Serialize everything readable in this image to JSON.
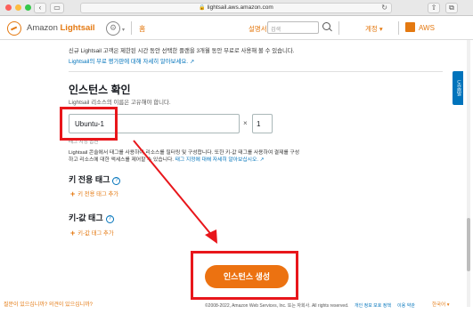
{
  "browser": {
    "url": "lightsail.aws.amazon.com"
  },
  "header": {
    "brand_prefix": "Amazon ",
    "brand_name": "Lightsail",
    "home": "홈",
    "support": "설명서",
    "search_placeholder": "검색",
    "account": "계정",
    "aws": "AWS"
  },
  "help_tab": "도움말",
  "intro": {
    "text": "신규 Lightsail 고객은 제한된 시간 동안 선택한 플랜을 3개월 동안 무료로 사용해 볼 수 있습니다.",
    "link": "Lightsail의 무료 평가판에 대해 자세히 알아보세요."
  },
  "instance_section": {
    "title": "인스턴스 확인",
    "description": "Lightsail 리소스의 이름은 고유해야 합니다.",
    "name_value": "Ubuntu-1",
    "times": "×",
    "quantity": "1",
    "hint": "태그 지정 옵션",
    "tag_desc_line1": "Lightsail 콘솔에서 태그를 사용하여 리소스를 필터링 및 구성합니다. 또한 키-값 태그를 사용하여 결제를 구성",
    "tag_desc_line2": "하고 리소스에 대한 액세스를 제어할 수 있습니다.",
    "tag_desc_link": "태그 지정에 대해 자세히 알아보십시오."
  },
  "key_tags": {
    "title": "키 전용 태그",
    "help": "?",
    "add": "키 전용 태그 추가"
  },
  "kv_tags": {
    "title": "키-값 태그",
    "help": "?",
    "add": "키-값 태그 추가"
  },
  "create_button": "인스턴스 생성",
  "footer": {
    "question": "질문이 있으십니까? 의견이 있으십니까?",
    "copyright": "©2008-2022, Amazon Web Services, Inc. 또는 자회사. All rights reserved.",
    "privacy": "개인 정보 보호 정책",
    "terms": "이용 약관",
    "language": "한국어"
  },
  "colors": {
    "accent": "#ec7211",
    "link": "#0073bb",
    "annotation": "#e8161b"
  }
}
